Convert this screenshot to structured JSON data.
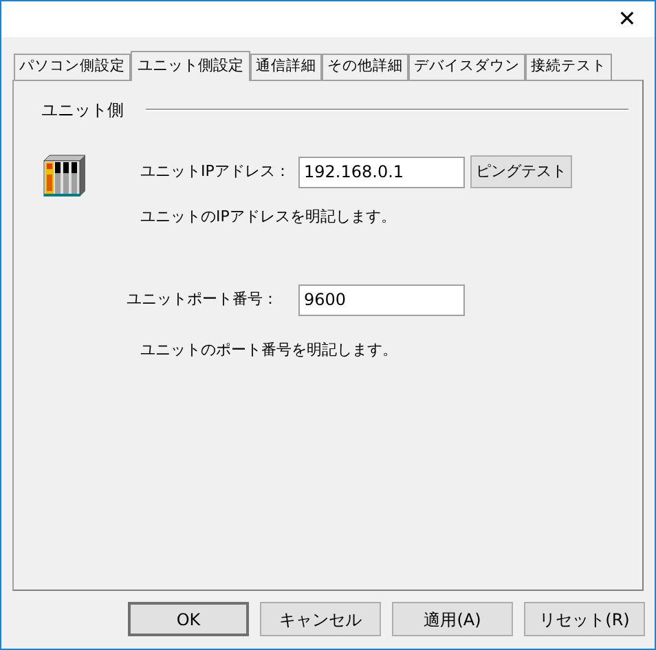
{
  "window": {
    "close": "✕"
  },
  "tabs": [
    {
      "label": "パソコン側設定",
      "selected": false
    },
    {
      "label": "ユニット側設定",
      "selected": true
    },
    {
      "label": "通信詳細",
      "selected": false
    },
    {
      "label": "その他詳細",
      "selected": false
    },
    {
      "label": "デバイスダウン",
      "selected": false
    },
    {
      "label": "接続テスト",
      "selected": false
    }
  ],
  "group": {
    "title": "ユニット側"
  },
  "ip": {
    "label": "ユニットIPアドレス：",
    "value": "192.168.0.1",
    "button": "ピングテスト",
    "description": "ユニットのIPアドレスを明記します。"
  },
  "port": {
    "label": "ユニットポート番号：",
    "value": "9600",
    "description": "ユニットのポート番号を明記します。"
  },
  "buttons": [
    {
      "label": "OK",
      "default": true
    },
    {
      "label": "キャンセル",
      "default": false
    },
    {
      "label": "適用(A)",
      "default": false
    },
    {
      "label": "リセット(R)",
      "default": false
    }
  ]
}
